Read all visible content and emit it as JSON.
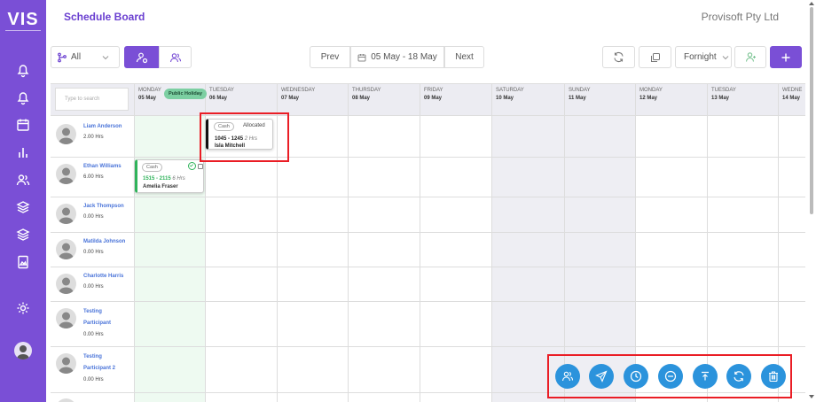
{
  "app": {
    "logo_text": "VIS",
    "title": "Schedule Board",
    "company": "Provisoft Pty Ltd"
  },
  "sidebar": {
    "items": [
      {
        "icon": "bell-icon"
      },
      {
        "icon": "bell-icon"
      },
      {
        "icon": "calendar-icon"
      },
      {
        "icon": "bar-chart-icon"
      },
      {
        "icon": "users-icon"
      },
      {
        "icon": "layers-icon"
      },
      {
        "icon": "layers-icon"
      },
      {
        "icon": "document-image-icon"
      },
      {
        "icon": "gear-icon"
      }
    ],
    "avatar": "user-avatar"
  },
  "toolbar": {
    "filter_value": "All",
    "prev_label": "Prev",
    "date_range": "05 May - 18 May",
    "next_label": "Next",
    "period_value": "Fornight"
  },
  "grid": {
    "search_placeholder": "Type to search",
    "holiday_badge": "Public Holiday",
    "days": [
      {
        "name": "MONDAY",
        "date": "05 May"
      },
      {
        "name": "TUESDAY",
        "date": "06 May"
      },
      {
        "name": "WEDNESDAY",
        "date": "07 May"
      },
      {
        "name": "THURSDAY",
        "date": "08 May"
      },
      {
        "name": "FRIDAY",
        "date": "09 May"
      },
      {
        "name": "SATURDAY",
        "date": "10 May"
      },
      {
        "name": "SUNDAY",
        "date": "11 May"
      },
      {
        "name": "MONDAY",
        "date": "12 May"
      },
      {
        "name": "TUESDAY",
        "date": "13 May"
      },
      {
        "name": "WEDNE",
        "date": "14 May"
      }
    ],
    "people": [
      {
        "name": "Liam Anderson",
        "name2": "",
        "hours": "2.00 Hrs"
      },
      {
        "name": "Ethan Williams",
        "name2": "",
        "hours": "6.00 Hrs"
      },
      {
        "name": "Jack Thompson",
        "name2": "",
        "hours": "0.00 Hrs"
      },
      {
        "name": "Matilda Johnson",
        "name2": "",
        "hours": "0.00 Hrs"
      },
      {
        "name": "Charlotte Harris",
        "name2": "",
        "hours": "0.00 Hrs"
      },
      {
        "name": "Testing",
        "name2": "Participant",
        "hours": "0.00 Hrs"
      },
      {
        "name": "Testing",
        "name2": "Participant 2",
        "hours": "0.00 Hrs"
      }
    ]
  },
  "shifts": {
    "shift1": {
      "tag": "Cash",
      "status": "Allocated",
      "time": "1045 - 1245",
      "duration": "2 Hrs",
      "name": "Isla Mitchell",
      "accent": "#111111"
    },
    "shift2": {
      "tag": "Cash",
      "time": "1515 - 2115",
      "duration": "6 Hrs",
      "name": "Amelia Fraser",
      "accent": "#2fb35a"
    }
  },
  "actions": [
    {
      "icon": "users-icon"
    },
    {
      "icon": "send-icon"
    },
    {
      "icon": "clock-icon"
    },
    {
      "icon": "minus-circle-icon"
    },
    {
      "icon": "upload-icon"
    },
    {
      "icon": "refresh-icon"
    },
    {
      "icon": "trash-icon"
    }
  ],
  "colors": {
    "sidebar": "#7a4fd6",
    "accent": "#7a4fd6",
    "action": "#2b93dc",
    "highlight": "#ea1d25",
    "holiday": "#7ccfa2"
  }
}
